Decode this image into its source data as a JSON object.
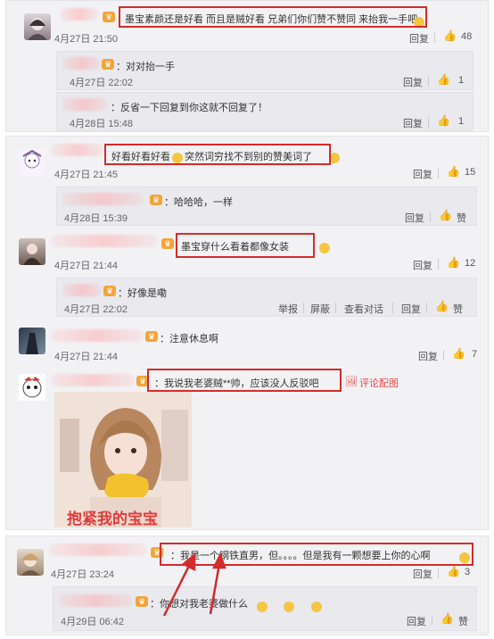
{
  "block1": {
    "comment": {
      "text": "墨宝素颜还是好看 而且是贼好看 兄弟们你们赞不赞同 来抬我一手吧",
      "time": "4月27日 21:50",
      "reply": "回复",
      "likes": "48"
    },
    "replies": [
      {
        "text": "：对对抬一手",
        "time": "4月27日 22:02",
        "reply": "回复",
        "likes": "1"
      },
      {
        "text": "：反省一下回复到你这就不回复了！",
        "time": "4月28日 15:48",
        "reply": "回复",
        "likes": "1"
      }
    ]
  },
  "block2": {
    "c1": {
      "text_a": "好看好看好看",
      "text_b": "突然词穷找不到别的赞美词了",
      "time": "4月27日 21:45",
      "reply": "回复",
      "likes": "15"
    },
    "c1_reply": {
      "text": "：哈哈哈，一样",
      "time": "4月28日 15:39",
      "reply": "回复",
      "like_label": "赞"
    },
    "c2": {
      "text": "墨宝穿什么看着都像女装",
      "time": "4月27日 21:44",
      "reply": "回复",
      "likes": "12"
    },
    "c2_reply": {
      "text": "：好像是嘞",
      "time": "4月27日 22:02",
      "report": "举报",
      "block": "屏蔽",
      "dialog": "查看对话",
      "reply": "回复",
      "like_label": "赞"
    },
    "c3": {
      "text": "：注意休息啊",
      "time": "4月27日 21:44",
      "reply": "回复",
      "likes": "7"
    },
    "c4": {
      "text": "：我说我老婆贼**帅，应该没人反驳吧",
      "gallery": "评论配图",
      "image_caption": "抱紧我的宝宝"
    }
  },
  "block3": {
    "comment": {
      "text_a": "：我是一个钢铁直男，但。。。。但是我有一颗想要上你的心啊",
      "time": "4月27日 23:24",
      "reply": "回复",
      "likes": "3"
    },
    "reply": {
      "text": "：你想对我老婆做什么",
      "time": "4月29日 06:42",
      "reply": "回复",
      "like_label": "赞"
    }
  },
  "icons": {
    "badge": "crown-badge-icon",
    "like": "thumbs-up-icon",
    "emoji": "smiley-emoji-icon",
    "gallery": "picture-icon"
  },
  "colors": {
    "highlight": "#d42b2b",
    "badge": "#f2a53a",
    "panel": "#f2f2f5"
  }
}
